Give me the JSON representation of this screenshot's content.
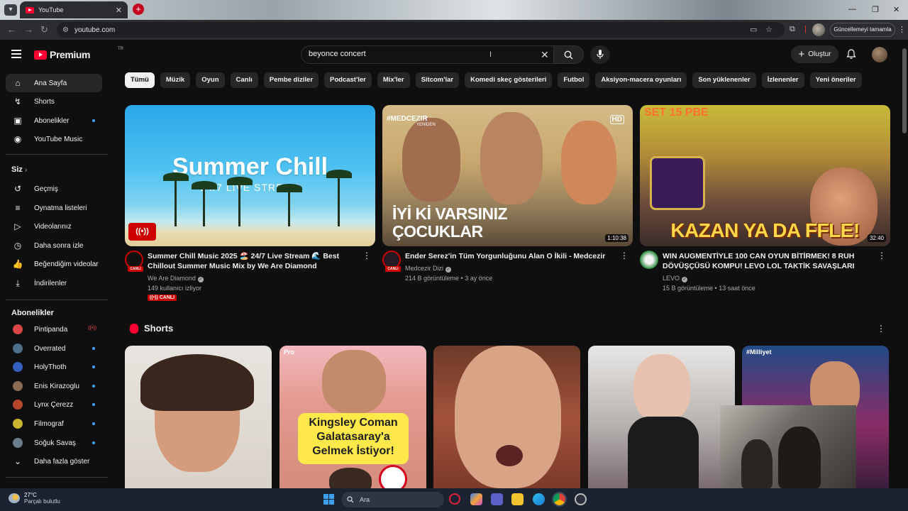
{
  "browser": {
    "tab_title": "YouTube",
    "url": "youtube.com",
    "update_button": "Güncellemeyi tamamla"
  },
  "masthead": {
    "logo_text": "Premium",
    "logo_region": "TR",
    "search_value": "beyonce concert",
    "create_label": "Oluştur"
  },
  "sidebar": {
    "main": [
      {
        "label": "Ana Sayfa",
        "icon": "home-icon"
      },
      {
        "label": "Shorts",
        "icon": "shorts-icon"
      },
      {
        "label": "Abonelikler",
        "icon": "subscriptions-icon"
      },
      {
        "label": "YouTube Music",
        "icon": "music-icon"
      }
    ],
    "you_header": "Siz",
    "you": [
      {
        "label": "Geçmiş",
        "icon": "history-icon"
      },
      {
        "label": "Oynatma listeleri",
        "icon": "playlist-icon"
      },
      {
        "label": "Videolarınız",
        "icon": "your-videos-icon"
      },
      {
        "label": "Daha sonra izle",
        "icon": "watch-later-icon"
      },
      {
        "label": "Beğendiğim videolar",
        "icon": "like-icon"
      },
      {
        "label": "İndirilenler",
        "icon": "download-icon"
      }
    ],
    "subs_header": "Abonelikler",
    "subs": [
      {
        "label": "Pintipanda",
        "color": "#d9474b"
      },
      {
        "label": "Overrated",
        "color": "#4d6f8a"
      },
      {
        "label": "HolyThoth",
        "color": "#3560c2"
      },
      {
        "label": "Enis Kirazoglu",
        "color": "#8a6c55"
      },
      {
        "label": "Lynx Çerezz",
        "color": "#b7452c"
      },
      {
        "label": "Filmograf",
        "color": "#c9b530"
      },
      {
        "label": "Soğuk Savaş",
        "color": "#6d7b8e"
      }
    ],
    "show_more": "Daha fazla göster"
  },
  "chips": [
    "Tümü",
    "Müzik",
    "Oyun",
    "Canlı",
    "Pembe diziler",
    "Podcast'ler",
    "Mix'ler",
    "Sitcom'lar",
    "Komedi skeç gösterileri",
    "Futbol",
    "Aksiyon-macera oyunları",
    "Son yüklenenler",
    "İzlenenler",
    "Yeni öneriler"
  ],
  "videos": [
    {
      "title": "Summer Chill Music 2025 🏖️ 24/7 Live Stream 🌊 Best Chillout Summer Music Mix by We Are Diamond",
      "channel": "We Are Diamond",
      "stats": "149 kullanıcı izliyor",
      "live_label": "((•)) CANLI",
      "avatar_tag": "CANLI",
      "thumb_title": "Summer Chill",
      "thumb_sub": "24/7 LIVE STREAM",
      "thumb_live_icon": "((•))"
    },
    {
      "title": "Ender Serez'in Tüm Yorgunluğunu Alan O İkili - Medcezir",
      "channel": "Medcezir Dizi",
      "stats": "214 B görüntüleme • 3 ay önce",
      "avatar_tag": "CANLI",
      "duration": "1:10:38",
      "thumb_line1": "İYİ Kİ VARSINIZ",
      "thumb_line2": "ÇOCUKLAR",
      "thumb_brand": "#MEDCEZIR",
      "thumb_brand_sub": "YENİDEN",
      "hd": "HD"
    },
    {
      "title": "WIN AUGMENTİYLE 100 CAN OYUN BİTİRMEK! 8 RUH DÖVÜŞÇÜSÜ KOMPU! LEVO LOL TAKTİK SAVAŞLARI",
      "channel": "LEVO",
      "stats": "15 B görüntüleme • 13 saat önce",
      "duration": "32:40",
      "thumb_text": "KAZAN YA DA FFLE!",
      "thumb_sub": "SET 15 PBE"
    }
  ],
  "shorts": {
    "header": "Shorts",
    "items": [
      {
        "tag": ""
      },
      {
        "tag": "Pro",
        "overlay": [
          "Kingsley Coman",
          "Galatasaray'a",
          "Gelmek İstiyor!"
        ]
      },
      {
        "tag": ""
      },
      {
        "tag": ""
      },
      {
        "tag": "#Milliyet"
      }
    ]
  },
  "taskbar": {
    "temp": "27°C",
    "weather": "Parçalı bulutlu",
    "search_placeholder": "Ara"
  }
}
